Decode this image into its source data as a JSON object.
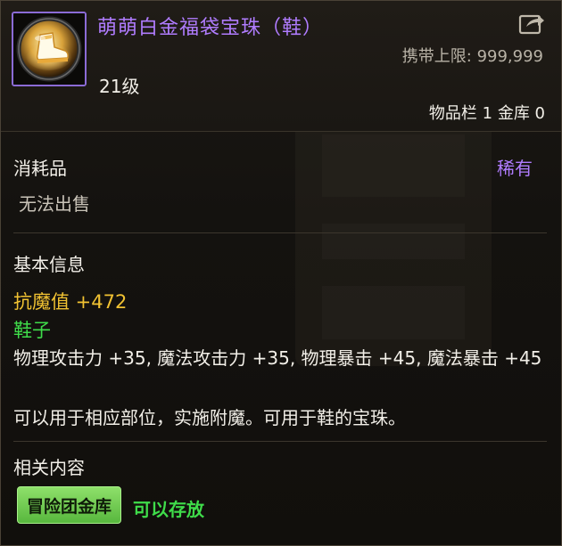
{
  "item": {
    "title": "萌萌白金福袋宝珠（鞋）",
    "icon": "boot-orb-icon",
    "carry_limit_label": "携带上限:",
    "carry_limit_value": "999,999",
    "level": "21级",
    "storage": "物品栏 1 金库 0"
  },
  "type": {
    "label": "消耗品",
    "rarity": "稀有",
    "sell_status": "无法出售"
  },
  "basic": {
    "title": "基本信息",
    "magic_resist": "抗魔值 +472",
    "slot": "鞋子",
    "stats": "物理攻击力 +35, 魔法攻击力 +35, 物理暴击 +45, 魔法暴击 +45",
    "usage": "可以用于相应部位，实施附魔。可用于鞋的宝珠。"
  },
  "related": {
    "title": "相关内容",
    "tag": "冒险团金库",
    "status": "可以存放"
  },
  "colors": {
    "title_purple": "#b07cff",
    "gold": "#f1c232",
    "green": "#3fdc4a",
    "tag_green": "#6cc84c",
    "border_purple": "#8b6bd6"
  },
  "icons": {
    "share": "share-arrow-icon"
  }
}
